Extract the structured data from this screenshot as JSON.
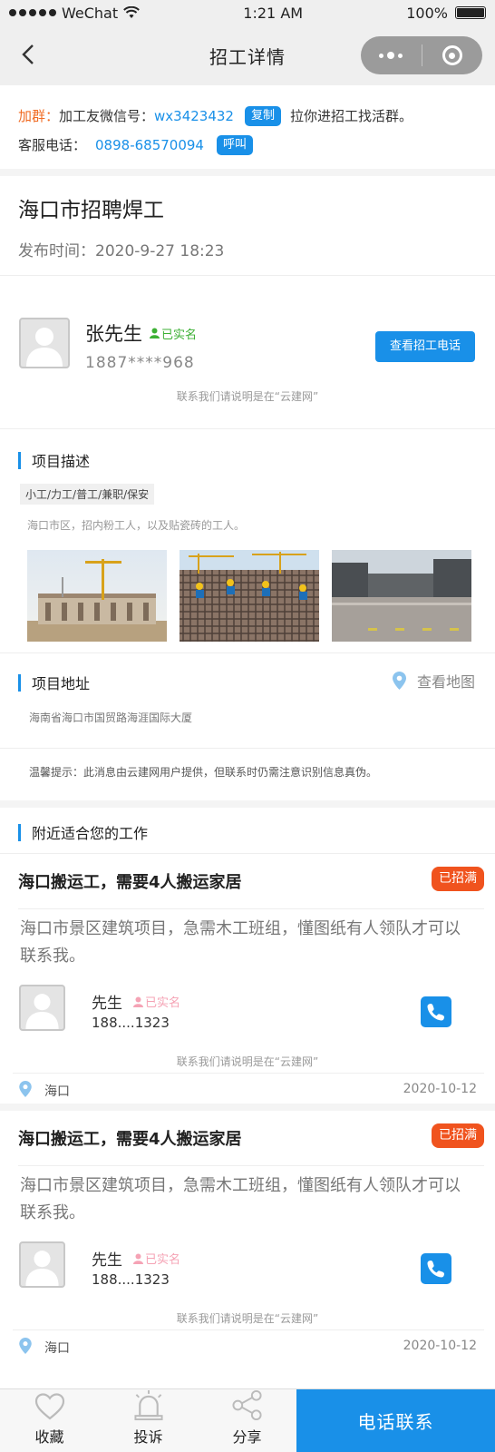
{
  "status_bar": {
    "carrier": "WeChat",
    "time": "1:21 AM",
    "battery": "100%"
  },
  "nav": {
    "title": "招工详情"
  },
  "group": {
    "label": "加群：",
    "wechat_label": "加工友微信号：",
    "wechat_id": "wx3423432",
    "copy_button": "复制",
    "suffix": "拉你进招工找活群。",
    "service_label": "客服电话：",
    "service_phone": "0898-68570094",
    "call_button": "呼叫"
  },
  "job": {
    "title": "海口市招聘焊工",
    "publish_label": "发布时间：",
    "publish_time": "2020-9-27 18:23"
  },
  "contact": {
    "name": "张先生",
    "verified": "已实名",
    "phone": "1887****968",
    "view_phone_button": "查看招工电话",
    "note": "联系我们请说明是在“云建网”"
  },
  "project": {
    "title": "项目描述",
    "tags": "小工/力工/普工/兼职/保安",
    "description": "海口市区，招内粉工人，以及贴瓷砖的工人。"
  },
  "address": {
    "title": "项目地址",
    "map_link": "查看地图",
    "value": "海南省海口市国贸路海涯国际大厦"
  },
  "tip": "温馨提示：此消息由云建网用户提供，但联系时仍需注意识别信息真伪。",
  "nearby": {
    "title": "附近适合您的工作",
    "items": [
      {
        "title": "海口搬运工，需要4人搬运家居",
        "badge": "已招满",
        "description": "海口市景区建筑项目，急需木工班组，懂图纸有人领队才可以联系我。",
        "name": "先生",
        "verified": "已实名",
        "phone": "188....1323",
        "note": "联系我们请说明是在“云建网”",
        "location": "海口",
        "date": "2020-10-12"
      },
      {
        "title": "海口搬运工，需要4人搬运家居",
        "badge": "已招满",
        "description": "海口市景区建筑项目，急需木工班组，懂图纸有人领队才可以联系我。",
        "name": "先生",
        "verified": "已实名",
        "phone": "188....1323",
        "note": "联系我们请说明是在“云建网”",
        "location": "海口",
        "date": "2020-10-12"
      }
    ]
  },
  "tabbar": {
    "favorite": "收藏",
    "complain": "投诉",
    "share": "分享",
    "contact": "电话联系"
  },
  "colors": {
    "accent": "#1990e8",
    "orange": "#f06b23",
    "badge": "#f0531e",
    "verified": "#3cb034"
  }
}
